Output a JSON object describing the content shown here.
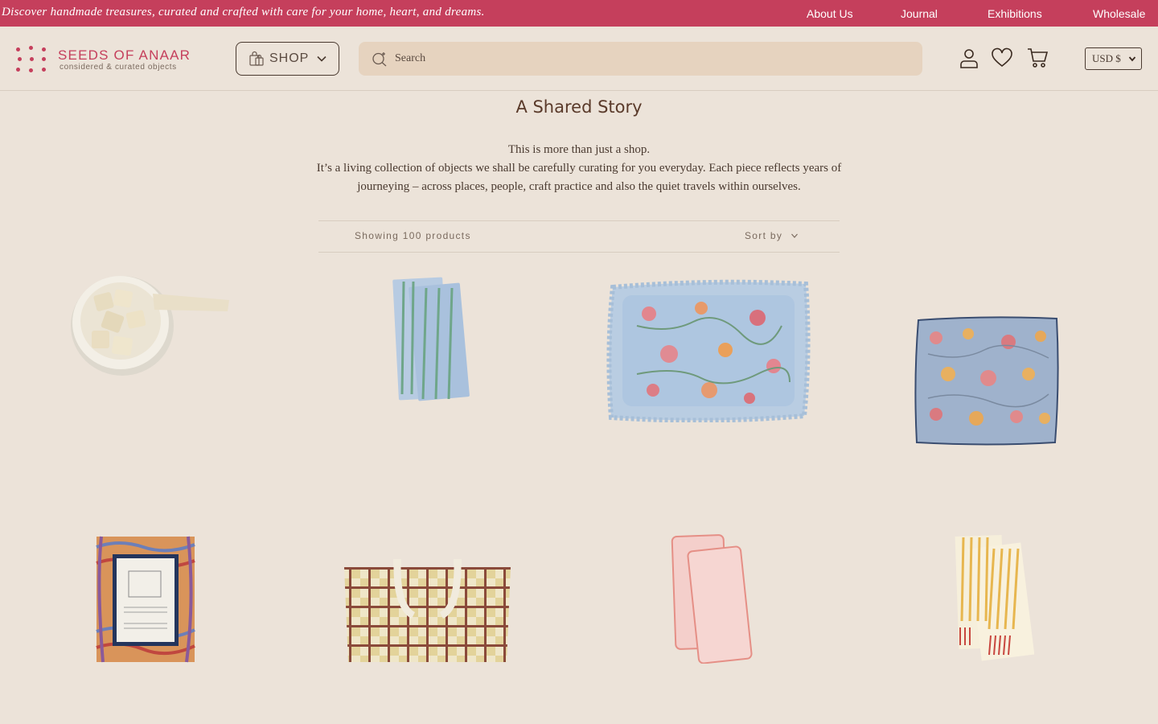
{
  "announcement": {
    "promo": "Discover handmade treasures, curated and crafted with care for your home, heart, and dreams.",
    "links": [
      "About Us",
      "Journal",
      "Exhibitions",
      "Wholesale"
    ]
  },
  "header": {
    "brand": "SEEDS OF ANAAR",
    "tagline": "considered & curated objects",
    "shop_label": "SHOP",
    "search_placeholder": "Search",
    "currency": "USD $"
  },
  "hero": {
    "title": "A Shared Story",
    "line1": "This is more than just a shop.",
    "line2": "It’s a living collection of objects we shall be carefully curating for you everyday. Each piece reflects years of journeying – across places, people, craft practice and also the quiet travels within ourselves."
  },
  "toolbar": {
    "count": "Showing 100 products",
    "sort": "Sort by"
  },
  "colors": {
    "accent": "#c53f5c",
    "background": "#ece3d9",
    "search_bg": "#e6d3bf"
  },
  "products": [
    {
      "icon": "soap-bowl-image"
    },
    {
      "icon": "blue-striped-napkins-image"
    },
    {
      "icon": "ruffled-floral-cushion-image"
    },
    {
      "icon": "floral-cushion-image"
    },
    {
      "icon": "marbled-picture-frame-image"
    },
    {
      "icon": "checkered-tote-bag-image"
    },
    {
      "icon": "pink-scalloped-napkins-image"
    },
    {
      "icon": "yellow-striped-towels-image"
    }
  ]
}
